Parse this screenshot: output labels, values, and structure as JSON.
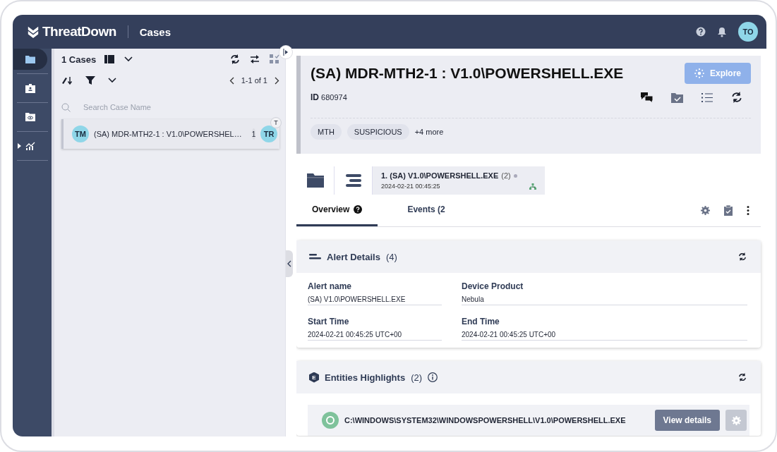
{
  "header": {
    "brand": "ThreatDown",
    "section": "Cases",
    "avatar": "TO"
  },
  "nav": [
    {
      "kind": "folder",
      "selected": true,
      "expandable": false
    },
    {
      "kind": "badge",
      "selected": false,
      "expandable": false
    },
    {
      "kind": "eye-folder",
      "selected": false,
      "expandable": false
    },
    {
      "kind": "chart",
      "selected": false,
      "expandable": true
    }
  ],
  "case_list": {
    "count": "1 Cases",
    "pagination": "1-1 of 1",
    "search": {
      "placeholder": "Search Case Name"
    },
    "cases": [
      {
        "avatar": "TM",
        "title": "(SA) MDR-MTH2-1 : V1.0\\POWERSHEL…",
        "alerts": "1",
        "assignee": "TR",
        "corner": "T",
        "selected": true
      }
    ]
  },
  "case": {
    "title": "(SA) MDR-MTH2-1 : V1.0\\POWERSHELL.EXE",
    "explore": "Explore",
    "id_label": "ID",
    "id": "680974",
    "tags": [
      "MTH",
      "SUSPICIOUS"
    ],
    "more": "+4 more"
  },
  "alert_strip": {
    "title": "1. (SA) V1.0\\POWERSHELL.EXE",
    "count": "(2)",
    "time": "2024-02-21 00:45:25"
  },
  "tabs": [
    {
      "label": "Overview",
      "selected": true,
      "help": true
    },
    {
      "label": "Events (2",
      "selected": false,
      "help": false
    }
  ],
  "alert_details": {
    "title": "Alert Details",
    "count": "(4)",
    "fields": [
      {
        "label": "Alert name",
        "value": "(SA) V1.0\\POWERSHELL.EXE"
      },
      {
        "label": "Device Product",
        "value": "Nebula"
      },
      {
        "label": "Start Time",
        "value": "2024-02-21 00:45:25 UTC+00"
      },
      {
        "label": "End Time",
        "value": "2024-02-21 00:45:25 UTC+00"
      }
    ]
  },
  "entities": {
    "title": "Entities Highlights",
    "count": "(2)",
    "badge": "E",
    "items": [
      {
        "path": "C:\\WINDOWS\\SYSTEM32\\WINDOWSPOWERSHELL\\V1.0\\POWERSHELL.EXE",
        "button": "View details"
      }
    ]
  }
}
